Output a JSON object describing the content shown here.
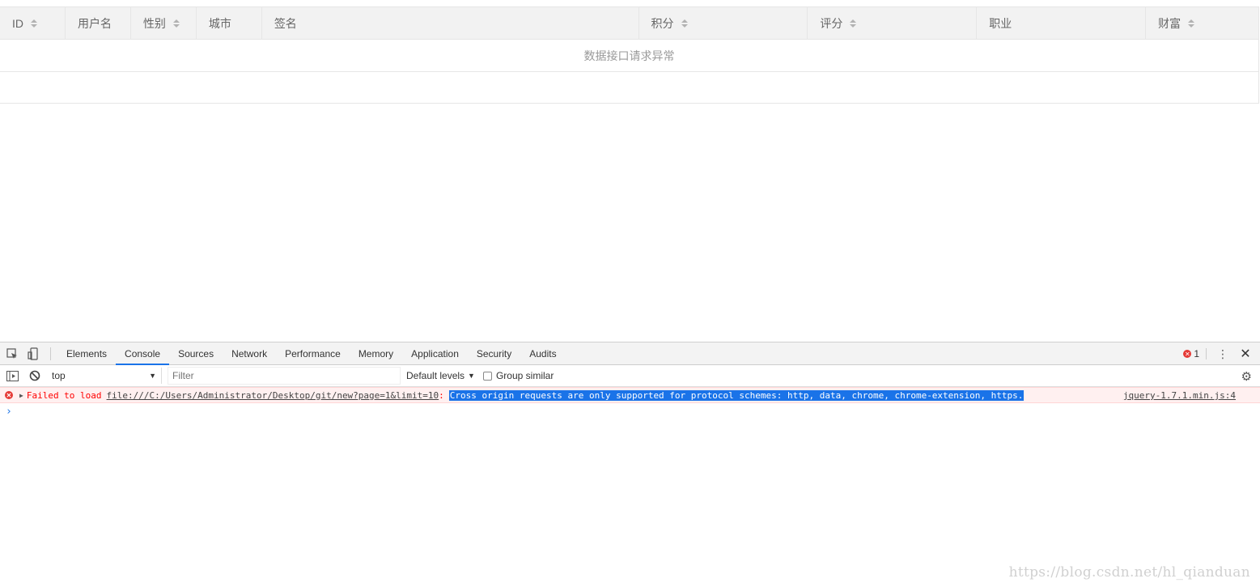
{
  "table": {
    "columns": [
      {
        "label": "ID",
        "sortable": true
      },
      {
        "label": "用户名",
        "sortable": false
      },
      {
        "label": "性别",
        "sortable": true
      },
      {
        "label": "城市",
        "sortable": false
      },
      {
        "label": "签名",
        "sortable": false
      },
      {
        "label": "积分",
        "sortable": true
      },
      {
        "label": "评分",
        "sortable": true
      },
      {
        "label": "职业",
        "sortable": false
      },
      {
        "label": "财富",
        "sortable": true
      }
    ],
    "empty_text": "数据接口请求异常"
  },
  "devtools": {
    "tabs": [
      "Elements",
      "Console",
      "Sources",
      "Network",
      "Performance",
      "Memory",
      "Application",
      "Security",
      "Audits"
    ],
    "active_tab": "Console",
    "error_count": "1",
    "context": "top",
    "filter_placeholder": "Filter",
    "levels_label": "Default levels",
    "group_similar_label": "Group similar",
    "message": {
      "prefix": "Failed to load",
      "url": "file:///C:/Users/Administrator/Desktop/git/new?page=1&limit=10",
      "colon": ":",
      "detail": "Cross origin requests are only supported for protocol schemes: http, data, chrome, chrome-extension, https.",
      "source": "jquery-1.7.1.min.js:4"
    },
    "prompt_symbol": "›"
  },
  "watermark": "https://blog.csdn.net/hl_qianduan",
  "colors": {
    "accent": "#1a73e8",
    "error": "#e53935",
    "header_bg": "#f2f2f2"
  }
}
